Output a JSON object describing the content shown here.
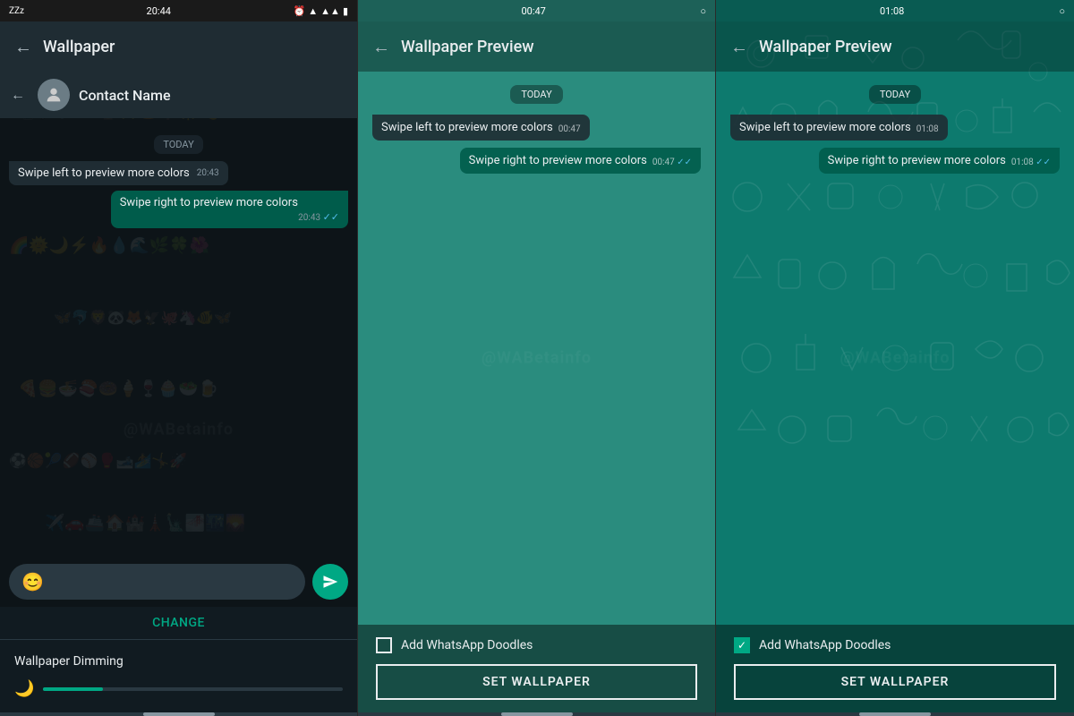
{
  "panel1": {
    "status": {
      "left": "ZZz",
      "time": "20:44",
      "icons": [
        "alarm",
        "wifi",
        "signal",
        "battery"
      ]
    },
    "header": {
      "back_label": "←",
      "title": "Wallpaper"
    },
    "contact": {
      "back_label": "←",
      "name": "Contact Name"
    },
    "date_badge": "TODAY",
    "messages": [
      {
        "type": "received",
        "text": "Swipe left to preview more colors",
        "time": "20:43"
      },
      {
        "type": "sent",
        "text": "Swipe right to preview more colors",
        "time": "20:43",
        "checkmarks": "✓✓"
      }
    ],
    "change_label": "CHANGE",
    "dimming": {
      "label": "Wallpaper Dimming"
    }
  },
  "panel2": {
    "status": {
      "time": "00:47"
    },
    "header": {
      "back_label": "←",
      "title": "Wallpaper Preview"
    },
    "date_badge": "TODAY",
    "messages": [
      {
        "type": "received",
        "text": "Swipe left to preview more colors",
        "time": "00:47"
      },
      {
        "type": "sent",
        "text": "Swipe right to preview more colors",
        "time": "00:47",
        "checkmarks": "✓✓"
      }
    ],
    "doodles_label": "Add WhatsApp Doodles",
    "doodles_checked": false,
    "set_wallpaper_label": "SET WALLPAPER"
  },
  "panel3": {
    "status": {
      "time": "01:08"
    },
    "header": {
      "back_label": "←",
      "title": "Wallpaper Preview"
    },
    "date_badge": "TODAY",
    "messages": [
      {
        "type": "received",
        "text": "Swipe left to preview more colors",
        "time": "01:08"
      },
      {
        "type": "sent",
        "text": "Swipe right to preview more colors",
        "time": "01:08",
        "checkmarks": "✓✓"
      }
    ],
    "doodles_label": "Add WhatsApp Doodles",
    "doodles_checked": true,
    "set_wallpaper_label": "SET WALLPAPER"
  },
  "watermark": "@WABetainfo"
}
